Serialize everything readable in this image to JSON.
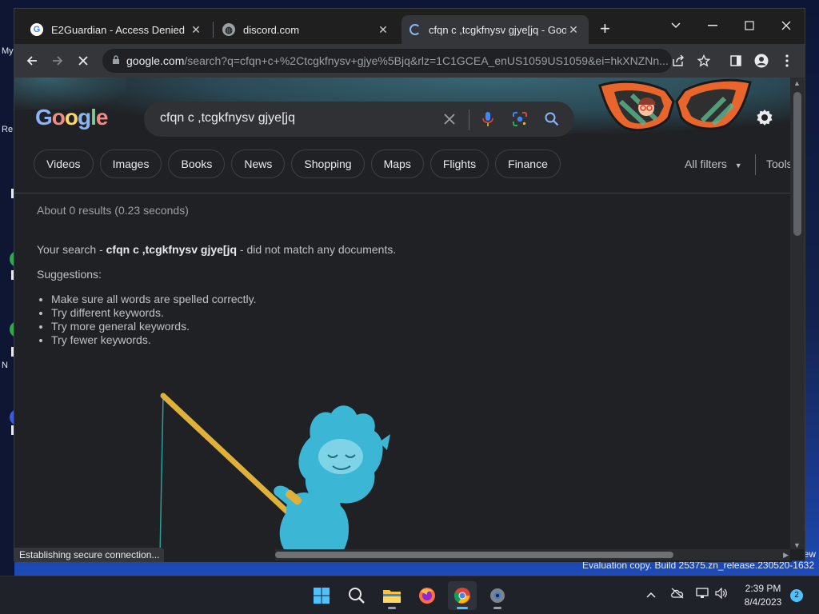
{
  "desktop": {
    "side_labels": [
      "My",
      "Re",
      "N"
    ],
    "watermark": "Evaluation copy. Build 25375.zn_release.230520-1632",
    "watermark_partial": "ew"
  },
  "browser": {
    "tabs": [
      {
        "title": "E2Guardian - Access Denied",
        "favicon": "google-g-icon"
      },
      {
        "title": "discord.com",
        "favicon": "globe-icon"
      },
      {
        "title": "cfqn c ,tcgkfnysv gjye[jq - Googl",
        "favicon": "loading-icon"
      }
    ],
    "new_tab": "+",
    "address": {
      "host": "google.com",
      "path": "/search?q=cfqn+c+%2Ctcgkfnysv+gjye%5Bjq&rlz=1C1GCEA_enUS1059US1059&ei=hkXNZNn..."
    },
    "status_text": "Establishing secure connection..."
  },
  "google": {
    "logo_letters": [
      "G",
      "o",
      "o",
      "g",
      "l",
      "e"
    ],
    "query": "cfqn c ,tcgkfnysv gjye[jq",
    "chips": [
      "Videos",
      "Images",
      "Books",
      "News",
      "Shopping",
      "Maps",
      "Flights",
      "Finance"
    ],
    "all_filters": "All filters",
    "tools": "Tools",
    "stats": "About 0 results (0.23 seconds)",
    "no_match_prefix": "Your search - ",
    "no_match_query": "cfqn c ,tcgkfnysv gjye[jq",
    "no_match_suffix": " - did not match any documents.",
    "suggestions_title": "Suggestions:",
    "suggestions": [
      "Make sure all words are spelled correctly.",
      "Try different keywords.",
      "Try more general keywords.",
      "Try fewer keywords."
    ]
  },
  "taskbar": {
    "apps": [
      "windows-start-icon",
      "search-icon",
      "file-explorer-icon",
      "firefox-icon",
      "chrome-icon",
      "settings-icon"
    ],
    "time": "2:39 PM",
    "date": "8/4/2023",
    "notification_count": "2"
  },
  "colors": {
    "page_bg": "#202124",
    "chrome_toolbar": "#35363a",
    "accent_blue": "#8ab4f8",
    "taskbar_accent": "#4cc2ff"
  }
}
